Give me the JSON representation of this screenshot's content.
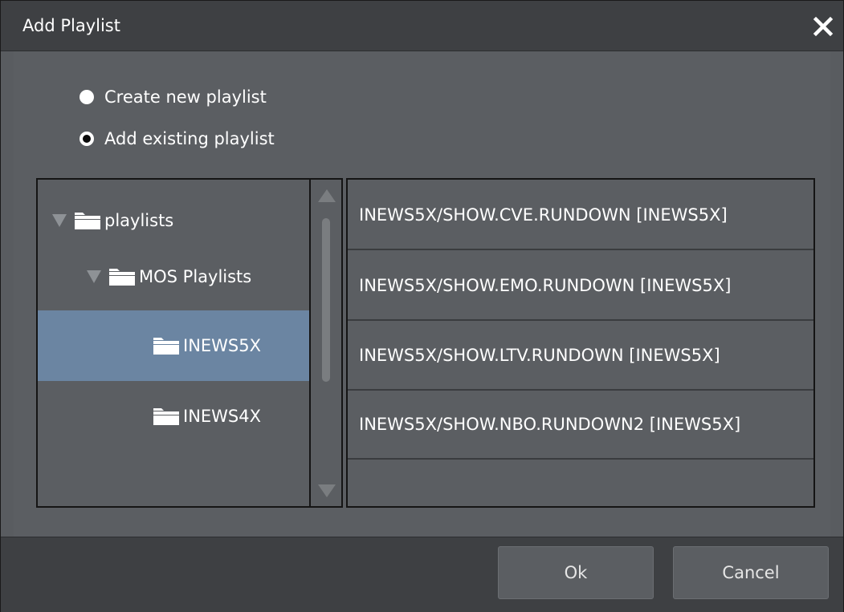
{
  "dialog": {
    "title": "Add Playlist",
    "close_icon": "close-icon"
  },
  "options": [
    {
      "label": "Create new playlist",
      "selected": false
    },
    {
      "label": "Add existing playlist",
      "selected": true
    }
  ],
  "tree": [
    {
      "label": "playlists",
      "expanded": true,
      "level": 0
    },
    {
      "label": "MOS Playlists",
      "expanded": true,
      "level": 1
    },
    {
      "label": "INEWS5X",
      "level": 2,
      "selected": true
    },
    {
      "label": "INEWS4X",
      "level": 2,
      "selected": false
    }
  ],
  "playlists": [
    "INEWS5X/SHOW.CVE.RUNDOWN [INEWS5X]",
    "INEWS5X/SHOW.EMO.RUNDOWN [INEWS5X]",
    "INEWS5X/SHOW.LTV.RUNDOWN [INEWS5X]",
    "INEWS5X/SHOW.NBO.RUNDOWN2 [INEWS5X]"
  ],
  "buttons": {
    "ok_label": "Ok",
    "cancel_label": "Cancel"
  },
  "colors": {
    "selected_row": "#6b85a2",
    "panel_bg": "#5b5e62",
    "titlebar_bg": "#3e4043"
  }
}
